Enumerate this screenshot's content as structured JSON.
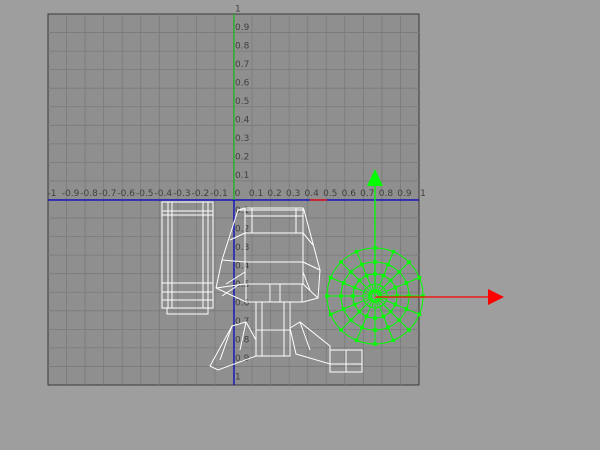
{
  "viewport": {
    "background_color": "#9e9e9e",
    "grid_fill_color": "#8f8f8f",
    "grid_line_color": "#7a7a7a",
    "border_color": "#3a3a3a",
    "axis_color": "#0000c8",
    "green_axis_color": "#00c800",
    "tick_label_color": "#404040"
  },
  "x_ticks": [
    "-1",
    "-0.9",
    "-0.8",
    "-0.7",
    "-0.6",
    "-0.5",
    "-0.4",
    "-0.3",
    "-0.2",
    "-0.1",
    "0",
    "0.1",
    "0.2",
    "0.3",
    "0.4",
    "0.5",
    "0.6",
    "0.7",
    "0.8",
    "0.9",
    "1"
  ],
  "y_ticks_up": [
    "0.1",
    "0.2",
    "0.3",
    "0.4",
    "0.5",
    "0.6",
    "0.7",
    "0.8",
    "0.9",
    "1"
  ],
  "y_ticks_down": [
    "0.1",
    "0.2",
    "0.3",
    "0.4",
    "0.5",
    "0.6",
    "0.7",
    "0.8",
    "0.9",
    "1"
  ],
  "wireframe": {
    "color": "#ffffff",
    "selected_color": "#00ff00"
  },
  "gizmo": {
    "x_arrow_color": "#ff0000",
    "y_arrow_color": "#00ff00",
    "icon": "move-gizmo-icon"
  }
}
